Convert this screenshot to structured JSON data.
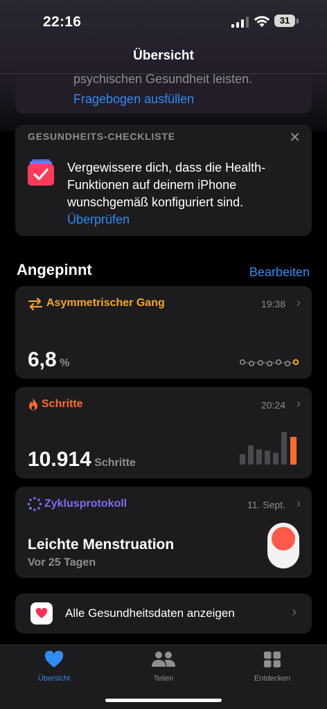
{
  "status_bar": {
    "time": "22:16",
    "battery_level": "31"
  },
  "nav": {
    "title": "Übersicht"
  },
  "previous_card": {
    "text": "psychischen Gesundheit leisten.",
    "link": "Fragebogen ausfüllen"
  },
  "checklist_card": {
    "header": "GESUNDHEITS-CHECKLISTE",
    "close": "✕",
    "text": "Vergewissere dich, dass die Health-Funktionen auf deinem iPhone wunschgemäß konfiguriert sind.",
    "link": "Überprüfen"
  },
  "pinned": {
    "title": "Angepinnt",
    "edit_label": "Bearbeiten",
    "asymmetric_gait": {
      "title": "Asymmetrischer Gang",
      "time": "19:38",
      "value": "6,8",
      "unit": "%",
      "color": "#f5a623"
    },
    "steps": {
      "title": "Schritte",
      "time": "20:24",
      "value": "10.914",
      "unit": "Schritte",
      "color": "#ff6a2c"
    },
    "cycle": {
      "title": "Zyklusprotokoll",
      "date": "11. Sept.",
      "status": "Leichte Menstruation",
      "ago": "Vor 25 Tagen",
      "color": "#7d6cf2"
    }
  },
  "all_health_data": {
    "label": "Alle Gesundheitsdaten anzeigen"
  },
  "tab_bar": {
    "tabs": [
      {
        "label": "Übersicht",
        "icon": "heart-icon",
        "active": true
      },
      {
        "label": "Teilen",
        "icon": "people-icon",
        "active": false
      },
      {
        "label": "Entdecken",
        "icon": "grid-icon",
        "active": false
      }
    ]
  },
  "colors": {
    "accent": "#2f8cf5",
    "background": "#000000",
    "card": "#1c1c1e"
  }
}
